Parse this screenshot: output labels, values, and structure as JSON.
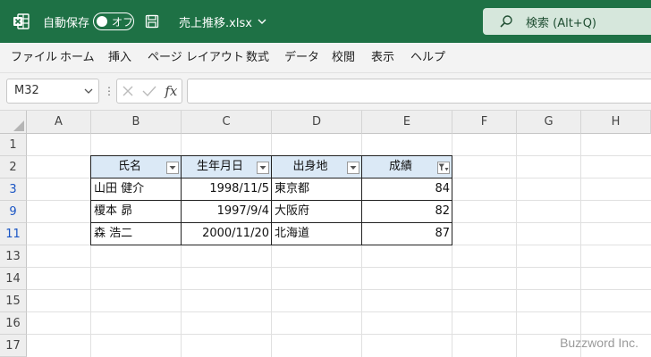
{
  "titlebar": {
    "autosave_label": "自動保存",
    "autosave_state": "オフ",
    "filename": "売上推移.xlsx",
    "search_placeholder": "検索 (Alt+Q)"
  },
  "menu": [
    "ファイル",
    "ホーム",
    "挿入",
    "ページ レイアウト",
    "数式",
    "データ",
    "校閲",
    "表示",
    "ヘルプ"
  ],
  "formula_bar": {
    "name_box": "M32",
    "formula": ""
  },
  "grid": {
    "columns": [
      "A",
      "B",
      "C",
      "D",
      "E",
      "F",
      "G",
      "H"
    ],
    "rows": [
      "1",
      "2",
      "3",
      "9",
      "11",
      "13",
      "14",
      "15",
      "16",
      "17"
    ],
    "filtered_rows": [
      "3",
      "9",
      "11"
    ]
  },
  "table": {
    "headers": [
      "氏名",
      "生年月日",
      "出身地",
      "成績"
    ],
    "rows": [
      [
        "山田 健介",
        "1998/11/5",
        "東京都",
        "84"
      ],
      [
        "榎本 昴",
        "1997/9/4",
        "大阪府",
        "82"
      ],
      [
        "森 浩二",
        "2000/11/20",
        "北海道",
        "87"
      ]
    ],
    "active_filter_column": "成績"
  },
  "watermark": "Buzzword Inc.",
  "colors": {
    "titlebar": "#1e7145",
    "table_header": "#dbe9f6",
    "filtered_row_number": "#1a55c4"
  }
}
